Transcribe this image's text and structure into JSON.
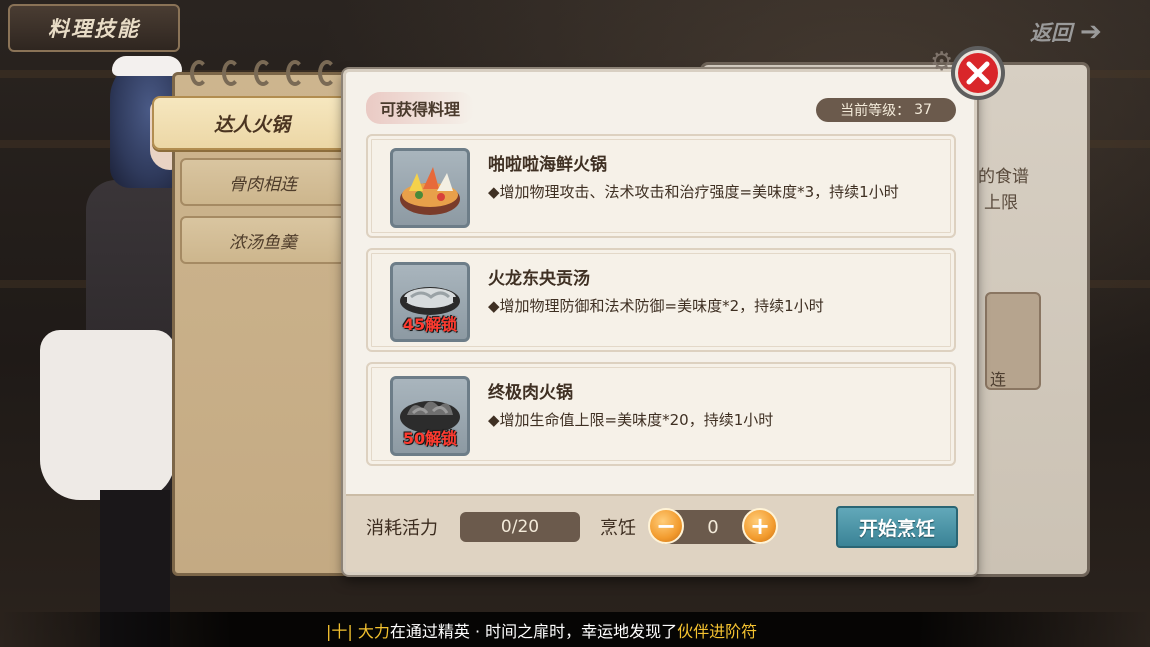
{
  "header": {
    "title": "料理技能",
    "back_label": "返回"
  },
  "sidebar": {
    "active_tab": "达人火锅",
    "tabs": [
      "骨肉相连",
      "浓汤鱼羹"
    ]
  },
  "background_panel": {
    "text_line1": "的食谱",
    "text_line2": "上限",
    "card_text": "连"
  },
  "modal": {
    "section_title": "可获得料理",
    "level_label": "当前等级：",
    "level_value": "37",
    "recipes": [
      {
        "name": "啪啦啦海鲜火锅",
        "description": "◆增加物理攻击、法术攻击和治疗强度=美味度*3，持续1小时",
        "locked": false,
        "unlock_label": ""
      },
      {
        "name": "火龙东央贡汤",
        "description": "◆增加物理防御和法术防御=美味度*2，持续1小时",
        "locked": true,
        "unlock_label": "45解锁"
      },
      {
        "name": "终极肉火锅",
        "description": "◆增加生命值上限=美味度*20，持续1小时",
        "locked": true,
        "unlock_label": "50解锁"
      }
    ],
    "footer": {
      "cost_label": "消耗活力",
      "cost_value": "0/20",
      "cook_label": "烹饪",
      "cook_count": "0",
      "minus_symbol": "−",
      "plus_symbol": "+",
      "start_button": "开始烹饪"
    }
  },
  "ticker": {
    "prefix": "|十|",
    "player": "大力",
    "middle": "在通过精英 · 时间之扉时，幸运地发现了",
    "item": "伙伴进阶符"
  },
  "colors": {
    "accent_teal": "#3a8396",
    "stepper_orange": "#f29b2e",
    "close_red": "#d9262a",
    "unlock_red": "#ff3b30",
    "ticker_gold": "#f4c230"
  }
}
